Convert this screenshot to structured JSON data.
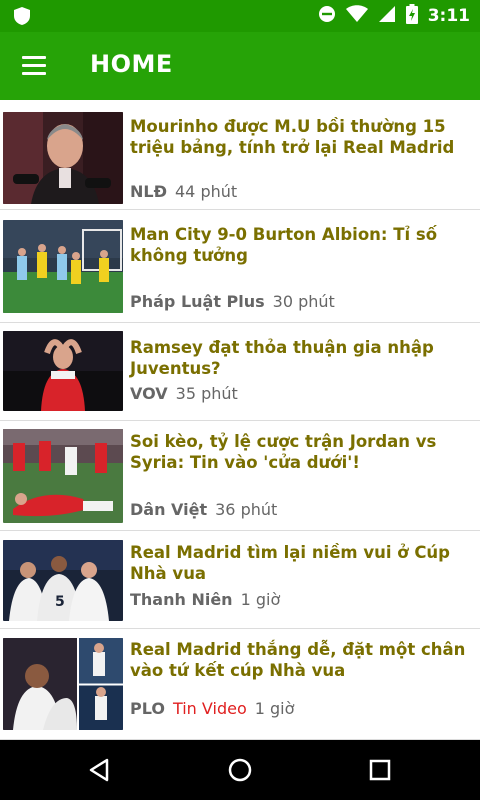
{
  "status_bar": {
    "time": "3:11",
    "icons": [
      "shield-icon",
      "do-not-disturb-icon",
      "wifi-icon",
      "signal-icon",
      "battery-charging-icon"
    ]
  },
  "app_bar": {
    "title": "HOME",
    "menu_icon": "hamburger-menu-icon"
  },
  "colors": {
    "status_bar": "#1f9900",
    "app_bar": "#26a307",
    "headline": "#7a6f00",
    "meta": "#666666",
    "video_tag": "#e02020"
  },
  "articles": [
    {
      "title": "Mourinho được M.U bồi thường 15 triệu bảng, tính trở lại Real Madrid",
      "source": "NLĐ",
      "tag": "",
      "time": "44 phút"
    },
    {
      "title": "Man City 9-0 Burton Albion: Tỉ số không tưởng",
      "source": "Pháp Luật Plus",
      "tag": "",
      "time": "30 phút"
    },
    {
      "title": "Ramsey đạt thỏa thuận gia nhập Juventus?",
      "source": "VOV",
      "tag": "",
      "time": "35 phút"
    },
    {
      "title": "Soi kèo, tỷ lệ cược trận Jordan vs Syria: Tin vào 'cửa dưới'!",
      "source": "Dân Việt",
      "tag": "",
      "time": "36 phút"
    },
    {
      "title": "Real Madrid tìm lại niềm vui ở Cúp Nhà vua",
      "source": "Thanh Niên",
      "tag": "",
      "time": "1 giờ"
    },
    {
      "title": "Real Madrid thắng dễ, đặt một chân vào tứ kết cúp Nhà vua",
      "source": "PLO",
      "tag": "Tin Video",
      "time": "1 giờ"
    }
  ],
  "nav_bar": {
    "icons": [
      "back-icon",
      "home-icon",
      "recents-icon"
    ]
  }
}
